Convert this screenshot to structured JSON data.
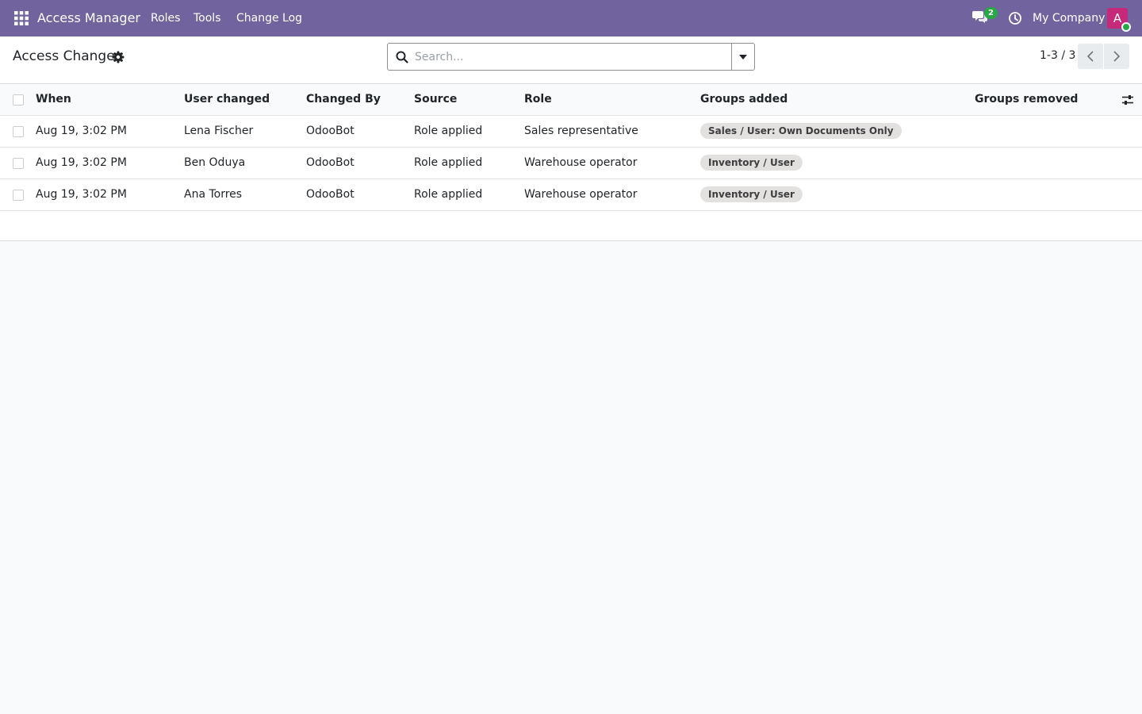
{
  "navbar": {
    "brand": "Access Manager",
    "menu": [
      {
        "label": "Roles"
      },
      {
        "label": "Tools"
      },
      {
        "label": "Change Log"
      }
    ],
    "chat_count": "2",
    "company": "My Company",
    "avatar_letter": "A",
    "colors": {
      "navbar_bg": "#71639e",
      "avatar_bg": "#c6297a",
      "badge_bg": "#28a745"
    }
  },
  "control_panel": {
    "title": "Access Changes",
    "search_placeholder": "Search...",
    "pager": "1-3 / 3"
  },
  "table": {
    "columns": [
      "When",
      "User changed",
      "Changed By",
      "Source",
      "Role",
      "Groups added",
      "Groups removed"
    ],
    "rows": [
      {
        "when": "Aug 19, 3:02 PM",
        "user": "Lena Fischer",
        "changed_by": "OdooBot",
        "source": "Role applied",
        "role": "Sales representative",
        "groups_added": "Sales / User: Own Documents Only",
        "groups_removed": ""
      },
      {
        "when": "Aug 19, 3:02 PM",
        "user": "Ben Oduya",
        "changed_by": "OdooBot",
        "source": "Role applied",
        "role": "Warehouse operator",
        "groups_added": "Inventory / User",
        "groups_removed": ""
      },
      {
        "when": "Aug 19, 3:02 PM",
        "user": "Ana Torres",
        "changed_by": "OdooBot",
        "source": "Role applied",
        "role": "Warehouse operator",
        "groups_added": "Inventory / User",
        "groups_removed": ""
      }
    ]
  }
}
